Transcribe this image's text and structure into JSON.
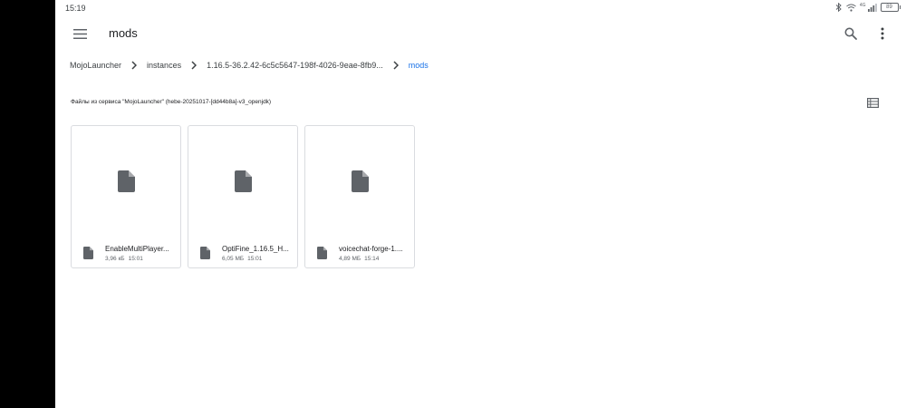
{
  "status_bar": {
    "time": "15:19",
    "network_label": "4G",
    "battery": "89"
  },
  "app_bar": {
    "title": "mods"
  },
  "breadcrumb": [
    {
      "label": "MojoLauncher"
    },
    {
      "label": "instances"
    },
    {
      "label": "1.16.5-36.2.42-6c5c5647-198f-4026-9eae-8fb9..."
    },
    {
      "label": "mods",
      "active": true
    }
  ],
  "source_info": "Файлы из сервиса \"MojoLauncher\" (hebe-20251017-[dd44b8a]-v3_openjdk)",
  "files": [
    {
      "name": "EnableMultiPlayer...",
      "size": "3,96 кБ",
      "time": "15:01"
    },
    {
      "name": "OptiFine_1.16.5_H...",
      "size": "6,05 МБ",
      "time": "15:01"
    },
    {
      "name": "voicechat-forge-1....",
      "size": "4,89 МБ",
      "time": "15:14"
    }
  ],
  "icons": {
    "menu": "menu-icon",
    "search": "search-icon",
    "more": "more-vert-icon",
    "chevron": "chevron-right-icon",
    "view_toggle": "list-view-icon",
    "file": "file-icon",
    "bluetooth": "bluetooth-icon",
    "wifi": "wifi-icon",
    "signal": "signal-icon",
    "battery": "battery-icon"
  },
  "colors": {
    "accent": "#1a73e8",
    "icon": "#5f6368",
    "text": "#202124",
    "card_border": "#dadce0"
  }
}
